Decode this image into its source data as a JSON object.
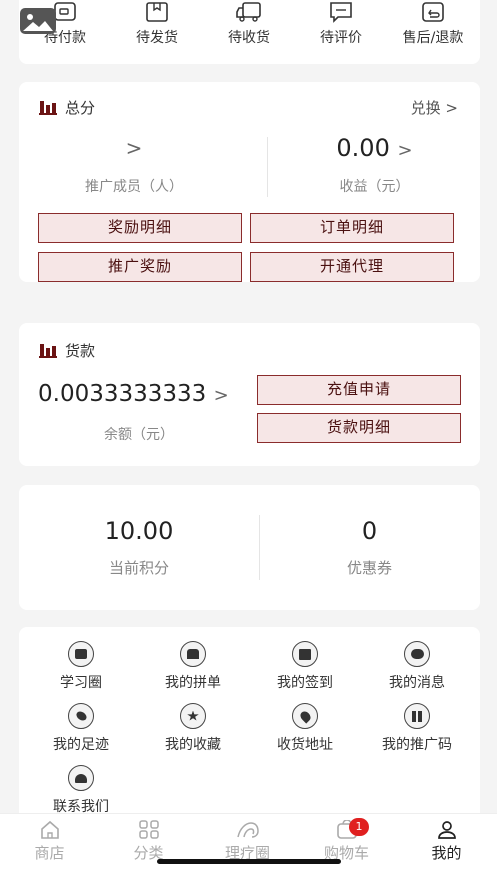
{
  "orders": {
    "items": [
      {
        "label": "待付款",
        "icon": "wallet-icon"
      },
      {
        "label": "待发货",
        "icon": "package-icon"
      },
      {
        "label": "待收货",
        "icon": "truck-icon"
      },
      {
        "label": "待评价",
        "icon": "comment-icon"
      },
      {
        "label": "售后/退款",
        "icon": "refund-icon"
      }
    ]
  },
  "total": {
    "title": "总分",
    "exchange": "兑换 >",
    "members_value": ">",
    "members_label": "推广成员（人）",
    "income_value": "0.00",
    "income_arrow": ">",
    "income_label": "收益（元）",
    "buttons": [
      "奖励明细",
      "订单明细",
      "推广奖励",
      "开通代理"
    ]
  },
  "payment": {
    "title": "货款",
    "balance": "0.0033333333",
    "balance_arrow": ">",
    "balance_label": "余额（元）",
    "buttons": [
      "充值申请",
      "货款明细"
    ]
  },
  "points": {
    "points_value": "10.00",
    "points_label": "当前积分",
    "coupon_value": "0",
    "coupon_label": "优惠券"
  },
  "tools": [
    {
      "label": "学习圈",
      "icon": "study-icon"
    },
    {
      "label": "我的拼单",
      "icon": "group-buy-icon"
    },
    {
      "label": "我的签到",
      "icon": "calendar-checkin-icon"
    },
    {
      "label": "我的消息",
      "icon": "message-icon"
    },
    {
      "label": "我的足迹",
      "icon": "footprint-icon"
    },
    {
      "label": "我的收藏",
      "icon": "star-icon"
    },
    {
      "label": "收货地址",
      "icon": "location-icon"
    },
    {
      "label": "我的推广码",
      "icon": "qr-code-icon"
    },
    {
      "label": "联系我们",
      "icon": "contact-icon"
    }
  ],
  "tabbar": {
    "tabs": [
      {
        "label": "商店",
        "icon": "home-icon"
      },
      {
        "label": "分类",
        "icon": "category-icon"
      },
      {
        "label": "理疗圈",
        "icon": "circle-icon"
      },
      {
        "label": "购物车",
        "icon": "cart-icon"
      },
      {
        "label": "我的",
        "icon": "profile-icon"
      }
    ],
    "cart_badge": "1",
    "active_tab": "我的"
  },
  "colors": {
    "accent": "#6b1414",
    "button_bg": "#f6e6e6",
    "badge": "#e02020"
  }
}
